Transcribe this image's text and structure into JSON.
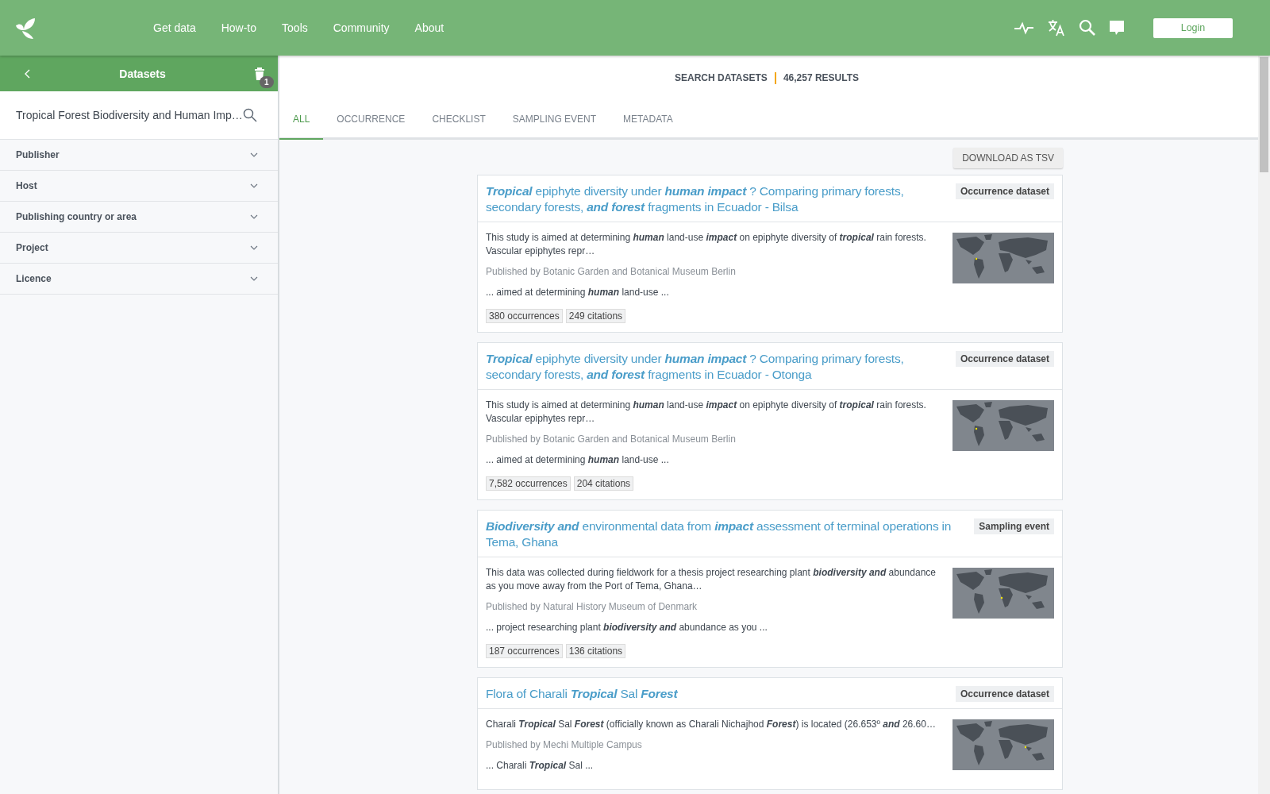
{
  "header": {
    "nav": [
      "Get data",
      "How-to",
      "Tools",
      "Community",
      "About"
    ],
    "login": "Login"
  },
  "sidebar": {
    "title": "Datasets",
    "badge": "1",
    "search": {
      "value": "Tropical Forest Biodiversity and Human Imp…"
    },
    "facets": [
      {
        "label": "Publisher"
      },
      {
        "label": "Host"
      },
      {
        "label": "Publishing country or area"
      },
      {
        "label": "Project"
      },
      {
        "label": "Licence"
      }
    ]
  },
  "results": {
    "heading": "SEARCH DATASETS",
    "count": "46,257 RESULTS",
    "tabs": [
      {
        "label": "ALL",
        "selected": true
      },
      {
        "label": "OCCURRENCE",
        "selected": false
      },
      {
        "label": "CHECKLIST",
        "selected": false
      },
      {
        "label": "SAMPLING EVENT",
        "selected": false
      },
      {
        "label": "METADATA",
        "selected": false
      }
    ],
    "download": "DOWNLOAD AS TSV",
    "datasets": [
      {
        "title": "*Tropical* epiphyte diversity under *human impact* ? Comparing primary forests, secondary forests, *and forest* fragments in Ecuador - Bilsa",
        "type": "Occurrence dataset",
        "description": "This study is aimed at determining *human* land-use *impact* on epiphyte diversity of *tropical* rain forests. Vascular epiphytes repr…",
        "publisher": "Published by Botanic Garden and Botanical Museum Berlin",
        "snippet": "... aimed at determining *human* land-use ...",
        "tags": [
          "380 occurrences",
          "249 citations"
        ]
      },
      {
        "title": "*Tropical* epiphyte diversity under *human impact* ? Comparing primary forests, secondary forests, *and forest* fragments in Ecuador - Otonga",
        "type": "Occurrence dataset",
        "description": "This study is aimed at determining *human* land-use *impact* on epiphyte diversity of *tropical* rain forests. Vascular epiphytes repr…",
        "publisher": "Published by Botanic Garden and Botanical Museum Berlin",
        "snippet": "... aimed at determining *human* land-use ...",
        "tags": [
          "7,582 occurrences",
          "204 citations"
        ]
      },
      {
        "title": "*Biodiversity and* environmental data from *impact* assessment of terminal operations in Tema, Ghana",
        "type": "Sampling event",
        "description": "This data was collected during fieldwork for a thesis project researching plant *biodiversity and* abundance as you move away from the Port of Tema, Ghana…",
        "publisher": "Published by Natural History Museum of Denmark",
        "snippet": "... project researching plant *biodiversity and* abundance as you ...",
        "tags": [
          "187 occurrences",
          "136 citations"
        ]
      },
      {
        "title": "Flora of Charali *Tropical* Sal *Forest*",
        "type": "Occurrence dataset",
        "description": "Charali *Tropical* Sal *Forest* (officially known as Charali Nichajhod *Forest*) is located (26.653º *and* 26.60…",
        "publisher": "Published by Mechi Multiple Campus",
        "snippet": "... Charali *Tropical* Sal ..."
      }
    ]
  }
}
